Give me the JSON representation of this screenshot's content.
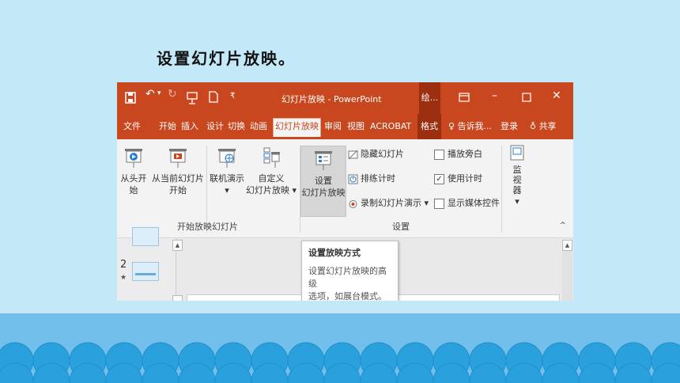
{
  "slide": {
    "title": "设置幻灯片放映。"
  },
  "window": {
    "title": "幻灯片放映 - PowerPoint",
    "mode_label": "绘...",
    "qa_icons": [
      "save-icon",
      "undo-icon",
      "redo-icon",
      "start-slideshow-icon",
      "new-icon",
      "customize-qa-icon"
    ],
    "controls": [
      "ribbon-display-icon",
      "minimize-icon",
      "maximize-icon",
      "close-icon"
    ]
  },
  "tabs": {
    "file": "文件",
    "home": "开始",
    "insert": "插入",
    "design": "设计",
    "transitions": "切换",
    "animations": "动画",
    "slideshow": "幻灯片放映",
    "review": "审阅",
    "view": "视图",
    "acrobat": "ACROBAT",
    "format": "格式",
    "tellme": "告诉我...",
    "signin": "登录",
    "share": "共享"
  },
  "ribbon": {
    "from_beginning": "从头开始",
    "from_current_1": "从当前幻灯片",
    "from_current_2": "开始",
    "online_1": "联机演示",
    "online_2": "▾",
    "custom_1": "自定义",
    "custom_2": "幻灯片放映 ▾",
    "group_start": "开始放映幻灯片",
    "setup_1": "设置",
    "setup_2": "幻灯片放映",
    "hide_slide": "隐藏幻灯片",
    "rehearse": "排练计时",
    "record": "录制幻灯片演示 ▾",
    "play_narration": "播放旁白",
    "use_timings": "使用计时",
    "show_media": "显示媒体控件",
    "group_setup": "设置",
    "monitors": "监视器",
    "monitors_arrow": "▾",
    "collapse": "^",
    "checkboxes": {
      "play_narration": false,
      "use_timings": true,
      "show_media": false
    }
  },
  "thumbnails": {
    "slide_number": "2",
    "star": "★"
  },
  "tooltip": {
    "title": "设置放映方式",
    "desc_1": "设置幻灯片放映的高级",
    "desc_2": "选项，如展台模式。"
  },
  "colors": {
    "accent": "#c8471e",
    "accent_dark": "#9c2f10",
    "background": "#c3e8f8",
    "waves": "#2aa0dd"
  }
}
